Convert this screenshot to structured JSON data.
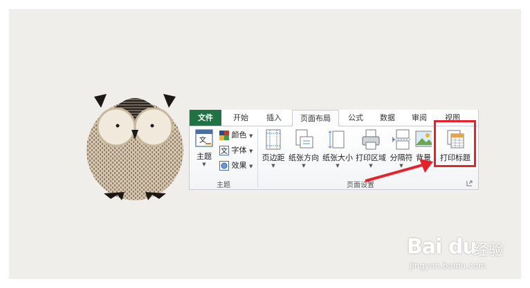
{
  "tabs": [
    {
      "label": "文件"
    },
    {
      "label": "开始"
    },
    {
      "label": "插入"
    },
    {
      "label": "页面布局"
    },
    {
      "label": "公式"
    },
    {
      "label": "数据"
    },
    {
      "label": "审阅"
    },
    {
      "label": "视图"
    }
  ],
  "theme_group": {
    "label": "主题",
    "themes_button": "主题",
    "colors_button": "颜色",
    "fonts_button": "字体",
    "effects_button": "效果"
  },
  "page_setup_group": {
    "label": "页面设置",
    "margins": "页边距",
    "orientation": "纸张方向",
    "size": "纸张大小",
    "print_area": "打印区域",
    "breaks": "分隔符",
    "background": "背景",
    "print_titles": "打印标题"
  },
  "watermark": {
    "logo": "Bai du",
    "brand_cn": "经验",
    "url": "jingyan.baidu.com"
  },
  "colors": {
    "file_tab": "#207245",
    "highlight": "#e8202a"
  }
}
